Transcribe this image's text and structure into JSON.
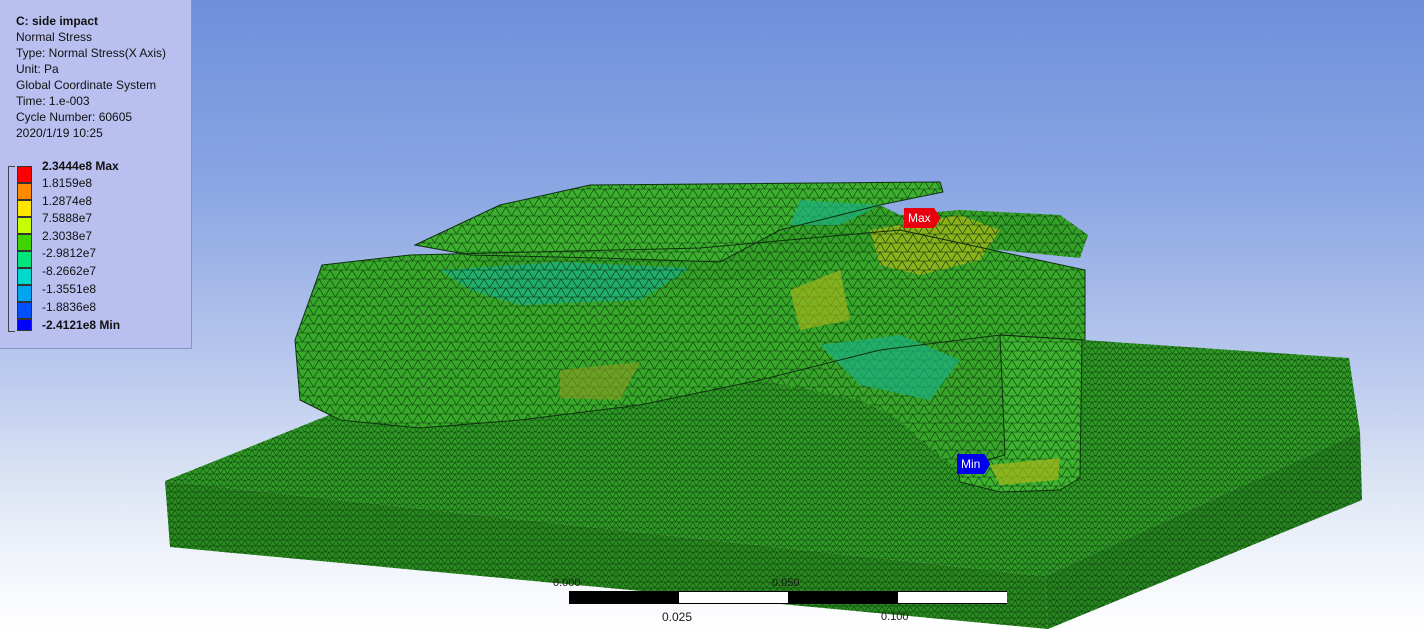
{
  "result": {
    "title": "C: side impact",
    "lines": [
      "Normal Stress",
      "Type: Normal Stress(X Axis)",
      "Unit: Pa",
      "Global Coordinate System",
      "Time: 1.e-003",
      "Cycle Number: 60605",
      "2020/1/19 10:25"
    ]
  },
  "legend": {
    "entries": [
      {
        "label": "2.3444e8 Max",
        "color": "#ff0000",
        "bold": true
      },
      {
        "label": "1.8159e8",
        "color": "#ff8a00",
        "bold": false
      },
      {
        "label": "1.2874e8",
        "color": "#ffe400",
        "bold": false
      },
      {
        "label": "7.5888e7",
        "color": "#c8ff00",
        "bold": false
      },
      {
        "label": "2.3038e7",
        "color": "#3fd400",
        "bold": false
      },
      {
        "label": "-2.9812e7",
        "color": "#00e47a",
        "bold": false
      },
      {
        "label": "-8.2662e7",
        "color": "#00d8cc",
        "bold": false
      },
      {
        "label": "-1.3551e8",
        "color": "#00a4f0",
        "bold": false
      },
      {
        "label": "-1.8836e8",
        "color": "#0050ff",
        "bold": false
      },
      {
        "label": "-2.4121e8 Min",
        "color": "#0000ff",
        "bold": true
      }
    ]
  },
  "probes": {
    "max_label": "Max",
    "min_label": "Min",
    "max_color": "#e8000f",
    "min_color": "#0000ee"
  },
  "scale": {
    "label": "0.025",
    "upper_ticks": [
      "0.000",
      "0.050",
      "0.100"
    ]
  }
}
